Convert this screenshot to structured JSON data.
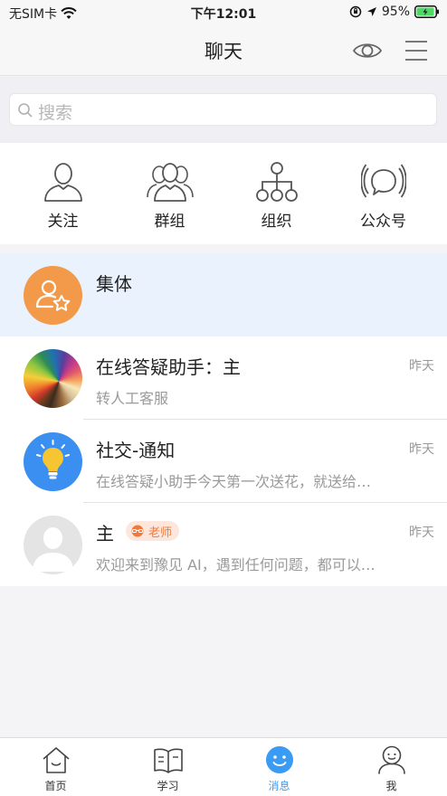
{
  "status_bar": {
    "carrier": "无SIM卡",
    "time": "下午12:01",
    "battery": "95%",
    "battery_level": 0.95
  },
  "header": {
    "title": "聊天",
    "icons": [
      "eye-icon",
      "menu-icon"
    ]
  },
  "search": {
    "placeholder": "搜索"
  },
  "quick_actions": [
    {
      "label": "关注",
      "icon": "person-icon"
    },
    {
      "label": "群组",
      "icon": "group-icon"
    },
    {
      "label": "组织",
      "icon": "org-tree-icon"
    },
    {
      "label": "公众号",
      "icon": "broadcast-icon"
    }
  ],
  "conversations": [
    {
      "title": "集体",
      "subtitle": "",
      "time": "",
      "avatar": "collective-avatar"
    },
    {
      "title": "在线答疑助手：主",
      "subtitle": "转人工客服",
      "time": "昨天",
      "avatar": "pencils-avatar"
    },
    {
      "title": "社交-通知",
      "subtitle": "在线答疑小助手今天第一次送花，就送给…",
      "time": "昨天",
      "avatar": "lightbulb-avatar"
    },
    {
      "title": "主",
      "badge": "老师",
      "subtitle": "欢迎来到豫见 AI，遇到任何问题，都可以…",
      "time": "昨天",
      "avatar": "default-user-avatar"
    }
  ],
  "tabs": [
    {
      "label": "首页",
      "icon": "home-icon",
      "active": false
    },
    {
      "label": "学习",
      "icon": "book-icon",
      "active": false
    },
    {
      "label": "消息",
      "icon": "message-icon",
      "active": true
    },
    {
      "label": "我",
      "icon": "profile-icon",
      "active": false
    }
  ],
  "colors": {
    "accent": "#3a9bf4",
    "highlight_row": "#e9f2fd",
    "orange_avatar": "#f39a4a",
    "badge_text": "#f07a3e",
    "battery": "#4cd964"
  }
}
